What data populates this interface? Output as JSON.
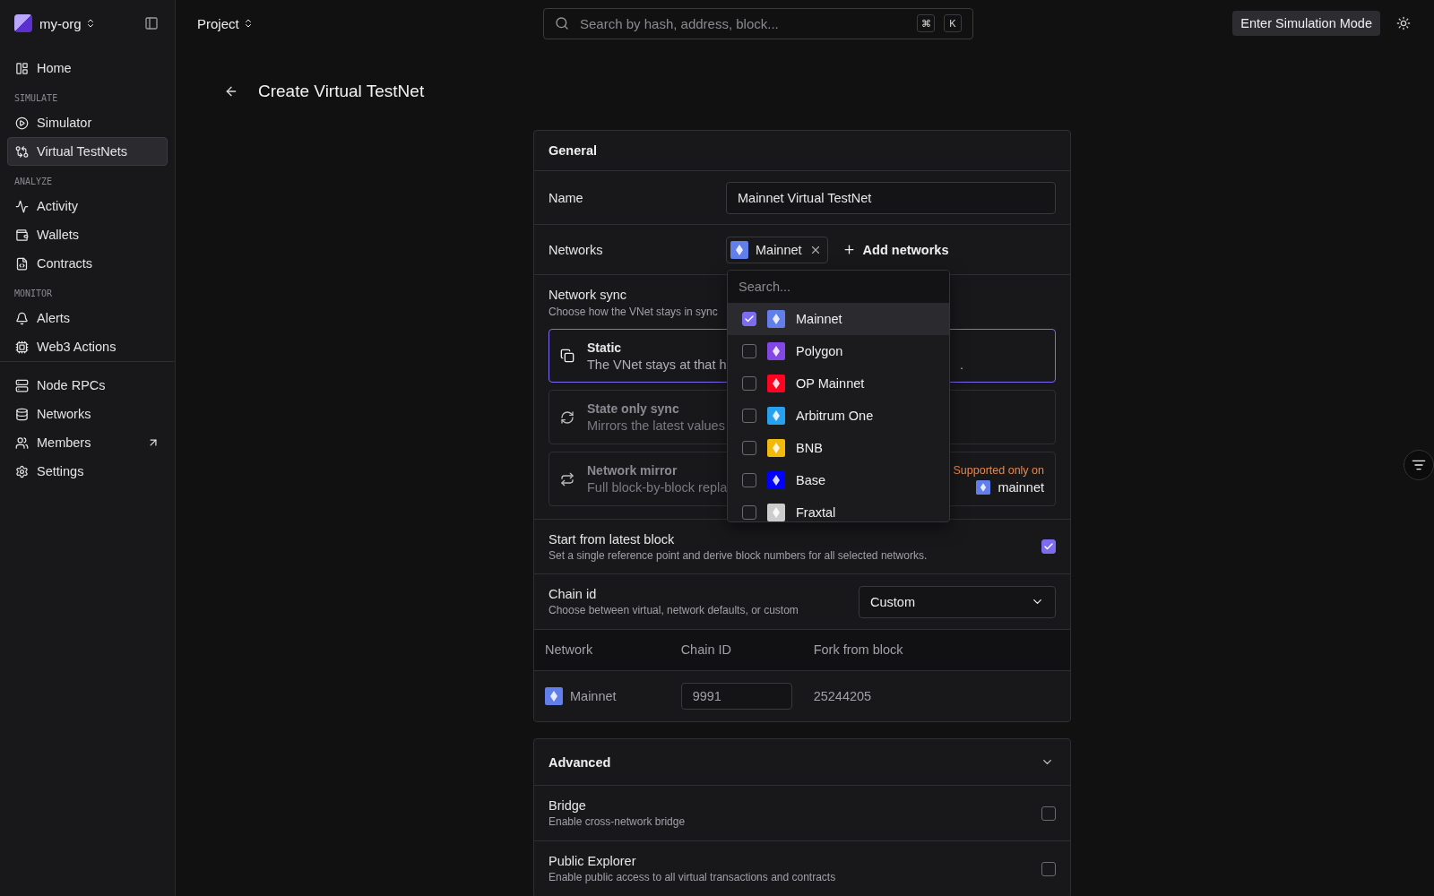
{
  "org": {
    "name": "my-org"
  },
  "sidebar": {
    "sections": [
      {
        "items": [
          {
            "label": "Home",
            "selected": false,
            "external": false
          }
        ]
      },
      {
        "heading": "SIMULATE",
        "items": [
          {
            "label": "Simulator",
            "selected": false,
            "external": false
          },
          {
            "label": "Virtual TestNets",
            "selected": true,
            "external": false
          }
        ]
      },
      {
        "heading": "ANALYZE",
        "items": [
          {
            "label": "Activity",
            "selected": false,
            "external": false
          },
          {
            "label": "Wallets",
            "selected": false,
            "external": false
          },
          {
            "label": "Contracts",
            "selected": false,
            "external": false
          }
        ]
      },
      {
        "heading": "MONITOR",
        "items": [
          {
            "label": "Alerts",
            "selected": false,
            "external": false
          },
          {
            "label": "Web3 Actions",
            "selected": false,
            "external": false
          }
        ]
      },
      {
        "divider": true,
        "items": [
          {
            "label": "Node RPCs",
            "selected": false,
            "external": false
          },
          {
            "label": "Networks",
            "selected": false,
            "external": false
          },
          {
            "label": "Members",
            "selected": false,
            "external": true
          },
          {
            "label": "Settings",
            "selected": false,
            "external": false
          }
        ]
      }
    ]
  },
  "topbar": {
    "project": "Project",
    "search": {
      "placeholder": "Search by hash, address, block...",
      "keys": [
        "⌘",
        "K"
      ]
    },
    "action": "Enter Simulation Mode"
  },
  "page": {
    "title": "Create Virtual TestNet"
  },
  "general": {
    "title": "General",
    "name": {
      "label": "Name",
      "value": "Mainnet Virtual TestNet"
    },
    "networks": {
      "label": "Networks",
      "chips": [
        {
          "label": "Mainnet",
          "color": "#627eea"
        }
      ],
      "add": "Add networks"
    },
    "sync": {
      "label": "Network sync",
      "description": "Choose how the VNet stays in sync",
      "options": [
        {
          "title": "Static",
          "description": "The VNet stays at that h",
          "tail": ".",
          "selected": true,
          "disabled": false
        },
        {
          "title": "State only sync",
          "description": "Mirrors the latest values",
          "selected": false,
          "disabled": true
        },
        {
          "title": "Network mirror",
          "description": "Full block-by-block repla",
          "selected": false,
          "disabled": true,
          "note": "Supported only on",
          "note_chip": "mainnet"
        }
      ]
    },
    "latest": {
      "label": "Start from latest block",
      "description": "Set a single reference point and derive block numbers for all selected networks.",
      "checked": true
    },
    "chain": {
      "label": "Chain id",
      "description": "Choose between virtual, network defaults, or custom",
      "value": "Custom"
    },
    "table": {
      "columns": [
        "Network",
        "Chain ID",
        "Fork from block"
      ],
      "rows": [
        {
          "network": "Mainnet",
          "color": "#627eea",
          "chain_id": "9991",
          "fork": "25244205"
        }
      ]
    }
  },
  "dropdown": {
    "placeholder": "Search...",
    "items": [
      {
        "label": "Mainnet",
        "checked": true,
        "color": "#627eea"
      },
      {
        "label": "Polygon",
        "checked": false,
        "color": "#8247e5"
      },
      {
        "label": "OP Mainnet",
        "checked": false,
        "color": "#ff0420"
      },
      {
        "label": "Arbitrum One",
        "checked": false,
        "color": "#28a0f0"
      },
      {
        "label": "BNB",
        "checked": false,
        "color": "#f0b90b"
      },
      {
        "label": "Base",
        "checked": false,
        "color": "#0000ff"
      },
      {
        "label": "Fraxtal",
        "checked": false,
        "color": "#cccccc"
      }
    ]
  },
  "advanced": {
    "title": "Advanced",
    "expanded": true,
    "options": [
      {
        "label": "Bridge",
        "description": "Enable cross-network bridge",
        "checked": false
      },
      {
        "label": "Public Explorer",
        "description": "Enable public access to all virtual transactions and contracts",
        "checked": false
      }
    ]
  }
}
